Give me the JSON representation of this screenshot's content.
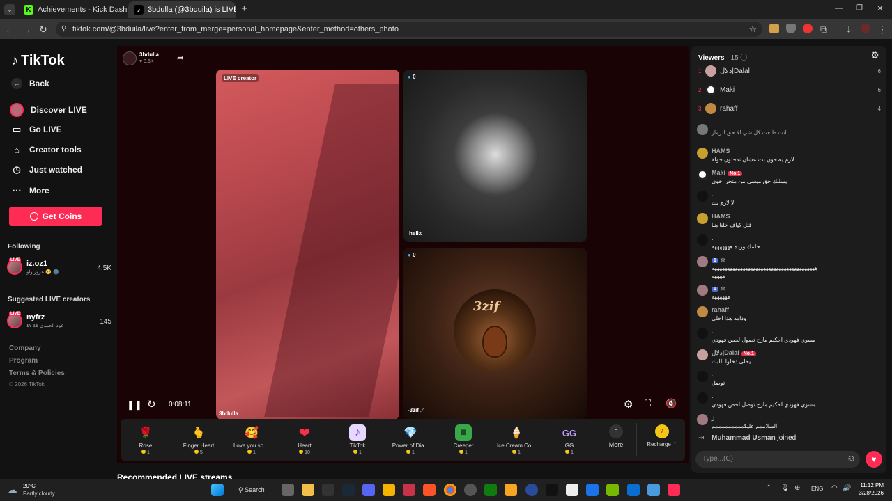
{
  "browser": {
    "tabs": [
      {
        "title": "Achievements - Kick Dashboard",
        "icon": "kick-icon"
      },
      {
        "title": "3bdulla (@3bduila) is LIVE",
        "icon": "tiktok-icon"
      }
    ],
    "new_tab": "+",
    "url": "tiktok.com/@3bduila/live?enter_from_merge=personal_homepage&enter_method=others_photo"
  },
  "sidebar": {
    "logo": "TikTok",
    "back": "Back",
    "nav": [
      {
        "label": "Discover LIVE",
        "icon": "avatar-icon"
      },
      {
        "label": "Go LIVE",
        "icon": "camera-icon"
      },
      {
        "label": "Creator tools",
        "icon": "home-icon"
      },
      {
        "label": "Just watched",
        "icon": "history-icon"
      },
      {
        "label": "More",
        "icon": "more-icon"
      }
    ],
    "get_coins": "Get Coins",
    "following_header": "Following",
    "following": [
      {
        "name": "iz.oz1",
        "sub": "عزوز واو 🥺 🌚",
        "count": "4.5K"
      }
    ],
    "suggested_header": "Suggested LIVE creators",
    "suggested": [
      {
        "name": "nyfrz",
        "sub": "عود الحموي ٤٤ ٤٧",
        "count": "145"
      }
    ],
    "footer": [
      "Company",
      "Program",
      "Terms & Policies",
      "© 2026 TikTok"
    ]
  },
  "stream": {
    "host_name": "3bdulla",
    "host_likes": "3.6K",
    "panels": [
      {
        "tag": "LIVE creator",
        "name": "3bdulla"
      },
      {
        "score": "0",
        "name": "hellx"
      },
      {
        "score": "0",
        "name": "-3zif",
        "art_text": "3zif"
      }
    ],
    "time": "0:08:11"
  },
  "gifts": [
    {
      "name": "Rose",
      "price": "1",
      "emoji": "🌹"
    },
    {
      "name": "Finger Heart",
      "price": "5",
      "emoji": "🫰"
    },
    {
      "name": "Love you so ...",
      "price": "1",
      "emoji": "🥰"
    },
    {
      "name": "Heart",
      "price": "10",
      "emoji": "❤"
    },
    {
      "name": "TikTok",
      "price": "1",
      "emoji": "♪"
    },
    {
      "name": "Power of Dia...",
      "price": "1",
      "emoji": "💎"
    },
    {
      "name": "Creeper",
      "price": "1",
      "emoji": "■"
    },
    {
      "name": "Ice Cream Co...",
      "price": "1",
      "emoji": "🍦"
    },
    {
      "name": "GG",
      "price": "1",
      "emoji": "GG"
    }
  ],
  "gift_more": "More",
  "recharge": "Recharge",
  "recommended_heading": "Recommended LIVE streams",
  "chat": {
    "viewers_label": "Viewers",
    "viewers_count": "· 15",
    "top_viewers": [
      {
        "rank": "1",
        "name": "دلال|Dalal",
        "score": "6"
      },
      {
        "rank": "2",
        "name": "Maki",
        "score": "6"
      },
      {
        "rank": "3",
        "name": "rahaff",
        "score": "4"
      }
    ],
    "messages": [
      {
        "name": "",
        "text": "انت طلعت كل شي الا حق الزمار",
        "badge": ""
      },
      {
        "name": "HAMS",
        "text": "لازم يطحون بث عشان تدخلون جولة",
        "badge": ""
      },
      {
        "name": "Maki",
        "text": "يسلبك حق ميسي من متجر اخوي",
        "badge": "No.1"
      },
      {
        "name": ".",
        "text": "لا لازم بث",
        "badge": ""
      },
      {
        "name": "HAMS",
        "text": "قتل كياف خلنا هنا",
        "badge": ""
      },
      {
        "name": ".",
        "text": "حلمك ورده هههههههه",
        "badge": ""
      },
      {
        "name": "",
        "text": "ههههههههههههههههههههههههههههههههههههههههه",
        "text2": "ههههه",
        "badge": "1",
        "badge_blue": true
      },
      {
        "name": "",
        "text": "ههههههه",
        "badge": "1",
        "badge_blue": true
      },
      {
        "name": "rahaff",
        "text": "ودامه هذا احلى",
        "badge": ""
      },
      {
        "name": ".",
        "text": "مسوي فهودي احكيم مارح تصول لحص فهودي",
        "badge": ""
      },
      {
        "name": "دلال|Dalal",
        "text": "يحلى دخلوا اللبث",
        "badge": "No.1"
      },
      {
        "name": ".",
        "text": "توصل",
        "badge": ""
      },
      {
        "name": ".",
        "text": "مسوي فهودي احكيم مارح توصل لحص فهودي",
        "badge": ""
      },
      {
        "name": "ز",
        "text": "السلاممم عليكمممممممممم",
        "badge": ""
      }
    ],
    "joined_name": "Muhammad Usman",
    "joined_text": "joined",
    "input_placeholder": "Type...(C)"
  },
  "taskbar": {
    "weather_temp": "20°C",
    "weather_desc": "Partly cloudy",
    "search": "Search",
    "lang": "ENG",
    "time": "11:12 PM",
    "date": "3/28/2026"
  },
  "colors": {
    "accent": "#fe2c55",
    "bg": "#121212",
    "chat_bg": "#1c1c1c"
  }
}
